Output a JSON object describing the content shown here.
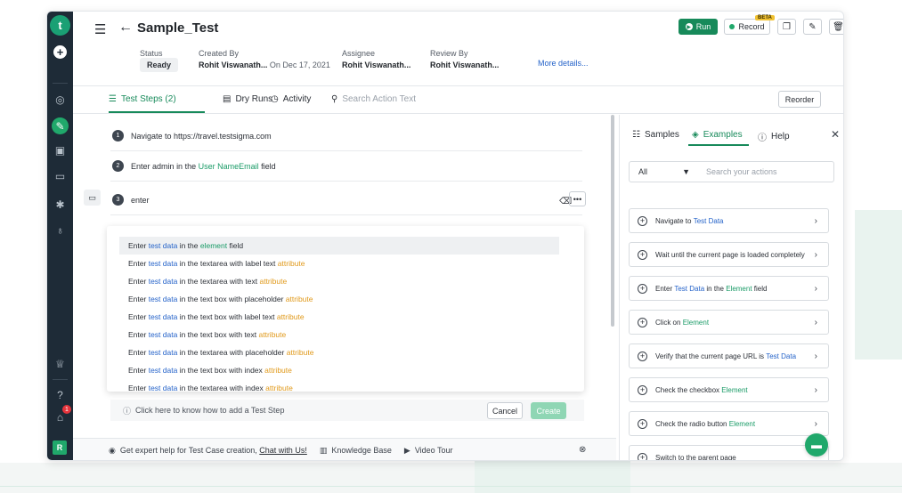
{
  "rail": {
    "logo": "t",
    "avatar": "R",
    "notification_count": "1",
    "icons": [
      "plus-icon",
      "dashboard-icon",
      "edit-icon",
      "briefcase-icon",
      "monitor-icon",
      "bug-icon",
      "bell-icon",
      "award-icon",
      "help-icon",
      "gift-icon"
    ]
  },
  "header": {
    "title": "Sample_Test",
    "status_label": "Status",
    "status_value": "Ready",
    "created_by_label": "Created By",
    "created_by_value": "Rohit Viswanath...",
    "created_on": "On Dec 17, 2021",
    "assignee_label": "Assignee",
    "assignee_value": "Rohit Viswanath...",
    "review_by_label": "Review By",
    "review_by_value": "Rohit Viswanath...",
    "more_details": "More details...",
    "run_label": "Run",
    "record_label": "Record",
    "beta_label": "BETA"
  },
  "tabs": {
    "test_steps": "Test Steps (2)",
    "dry_runs": "Dry Runs",
    "activity": "Activity",
    "search_placeholder": "Search Action Text",
    "reorder": "Reorder"
  },
  "steps": [
    {
      "num": "1",
      "prefix": "Navigate to",
      "url": "https://travel.testsigma.com"
    },
    {
      "num": "2",
      "prefix": "Enter",
      "data": "admin",
      "mid": "in the",
      "element": "User NameEmail",
      "suffix": "field"
    },
    {
      "num": "3",
      "text": "enter"
    }
  ],
  "suggestions": [
    {
      "a": "Enter",
      "b": "test data",
      "c": "in the",
      "d": "element",
      "e": "field",
      "d_color": "green"
    },
    {
      "a": "Enter",
      "b": "test data",
      "c": "in the textarea with label text",
      "d": "attribute",
      "e": "",
      "d_color": "orange"
    },
    {
      "a": "Enter",
      "b": "test data",
      "c": "in the textarea with text",
      "d": "attribute",
      "e": "",
      "d_color": "orange"
    },
    {
      "a": "Enter",
      "b": "test data",
      "c": "in the text box with placeholder",
      "d": "attribute",
      "e": "",
      "d_color": "orange"
    },
    {
      "a": "Enter",
      "b": "test data",
      "c": "in the text box with label text",
      "d": "attribute",
      "e": "",
      "d_color": "orange"
    },
    {
      "a": "Enter",
      "b": "test data",
      "c": "in the text box with text",
      "d": "attribute",
      "e": "",
      "d_color": "orange"
    },
    {
      "a": "Enter",
      "b": "test data",
      "c": "in the textarea with placeholder",
      "d": "attribute",
      "e": "",
      "d_color": "orange"
    },
    {
      "a": "Enter",
      "b": "test data",
      "c": "in the text box with index",
      "d": "attribute",
      "e": "",
      "d_color": "orange"
    },
    {
      "a": "Enter",
      "b": "test data",
      "c": "in the textarea with index",
      "d": "attribute",
      "e": "",
      "d_color": "orange"
    }
  ],
  "hint": {
    "text": "Click here to know how to add a Test Step",
    "cancel": "Cancel",
    "create": "Create"
  },
  "footer": {
    "help_text": "Get expert help for Test Case creation,",
    "chat_link": "Chat with Us!",
    "knowledge_base": "Knowledge Base",
    "video_tour": "Video Tour"
  },
  "right_panel": {
    "tab_samples": "Samples",
    "tab_examples": "Examples",
    "tab_help": "Help",
    "filter_value": "All",
    "search_placeholder": "Search your actions",
    "cards": [
      {
        "pre": "Navigate to",
        "hl": "Test Data",
        "hl_color": "blue",
        "post": "",
        "hl2": "",
        "post2": ""
      },
      {
        "pre": "Wait until the current page is loaded completely",
        "hl": "",
        "hl_color": "",
        "post": "",
        "hl2": "",
        "post2": ""
      },
      {
        "pre": "Enter",
        "hl": "Test Data",
        "hl_color": "blue",
        "post": "in the",
        "hl2": "Element",
        "post2": "field"
      },
      {
        "pre": "Click on",
        "hl": "Element",
        "hl_color": "green",
        "post": "",
        "hl2": "",
        "post2": ""
      },
      {
        "pre": "Verify that the current page URL is",
        "hl": "Test Data",
        "hl_color": "blue",
        "post": "",
        "hl2": "",
        "post2": ""
      },
      {
        "pre": "Check the checkbox",
        "hl": "Element",
        "hl_color": "green",
        "post": "",
        "hl2": "",
        "post2": ""
      },
      {
        "pre": "Check the radio button",
        "hl": "Element",
        "hl_color": "green",
        "post": "",
        "hl2": "",
        "post2": ""
      },
      {
        "pre": "Switch to the parent page",
        "hl": "",
        "hl_color": "",
        "post": "",
        "hl2": "",
        "post2": ""
      }
    ]
  },
  "colors": {
    "brand_green": "#178a5a",
    "rail_bg": "#1e2b37",
    "link_blue": "#2563c9",
    "attribute_orange": "#e0991a"
  }
}
